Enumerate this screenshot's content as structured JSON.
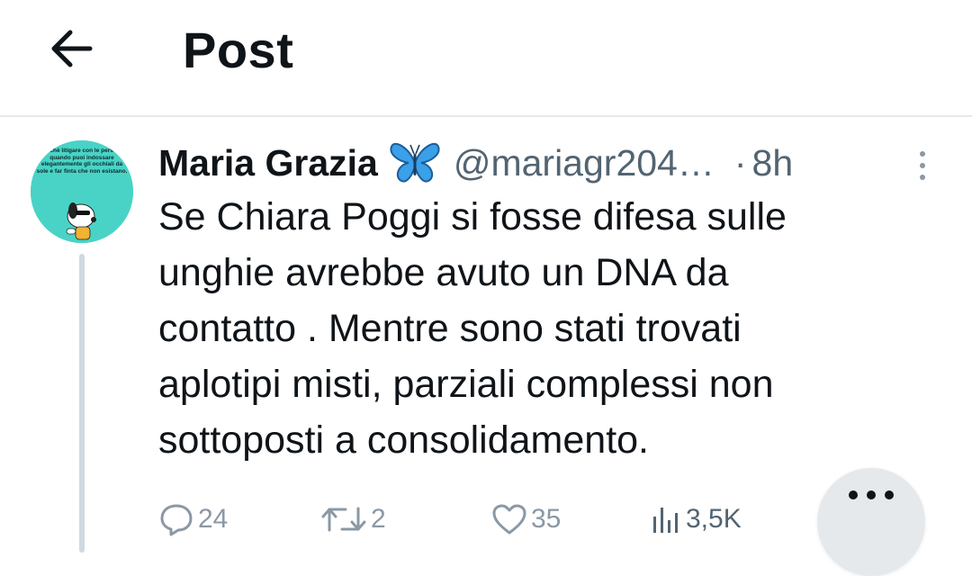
{
  "header": {
    "title": "Post",
    "back_icon": "arrow-left-icon"
  },
  "post": {
    "author": {
      "name": "Maria Grazia",
      "emoji_icon": "butterfly-icon",
      "handle": "@mariagr204…",
      "separator": "·",
      "time": "8h",
      "avatar_text": "Porchè litigare con le persone quando puoi indossare elegantemente gli occhiali da sole e far finta che non esistano."
    },
    "text": "Se Chiara Poggi si fosse difesa sulle\nunghie avrebbe avuto un DNA da\ncontatto . Mentre sono stati trovati\naplotipi misti, parziali complessi non\nsottoposti a consolidamento.",
    "stats": {
      "replies": "24",
      "reposts": "2",
      "likes": "35",
      "views": "3,5K"
    }
  },
  "colors": {
    "text": "#0f1419",
    "secondary": "#536471",
    "icon": "#8b98a5",
    "avatar_bg": "#49d3c6",
    "butterfly": "#3aa0e8"
  }
}
